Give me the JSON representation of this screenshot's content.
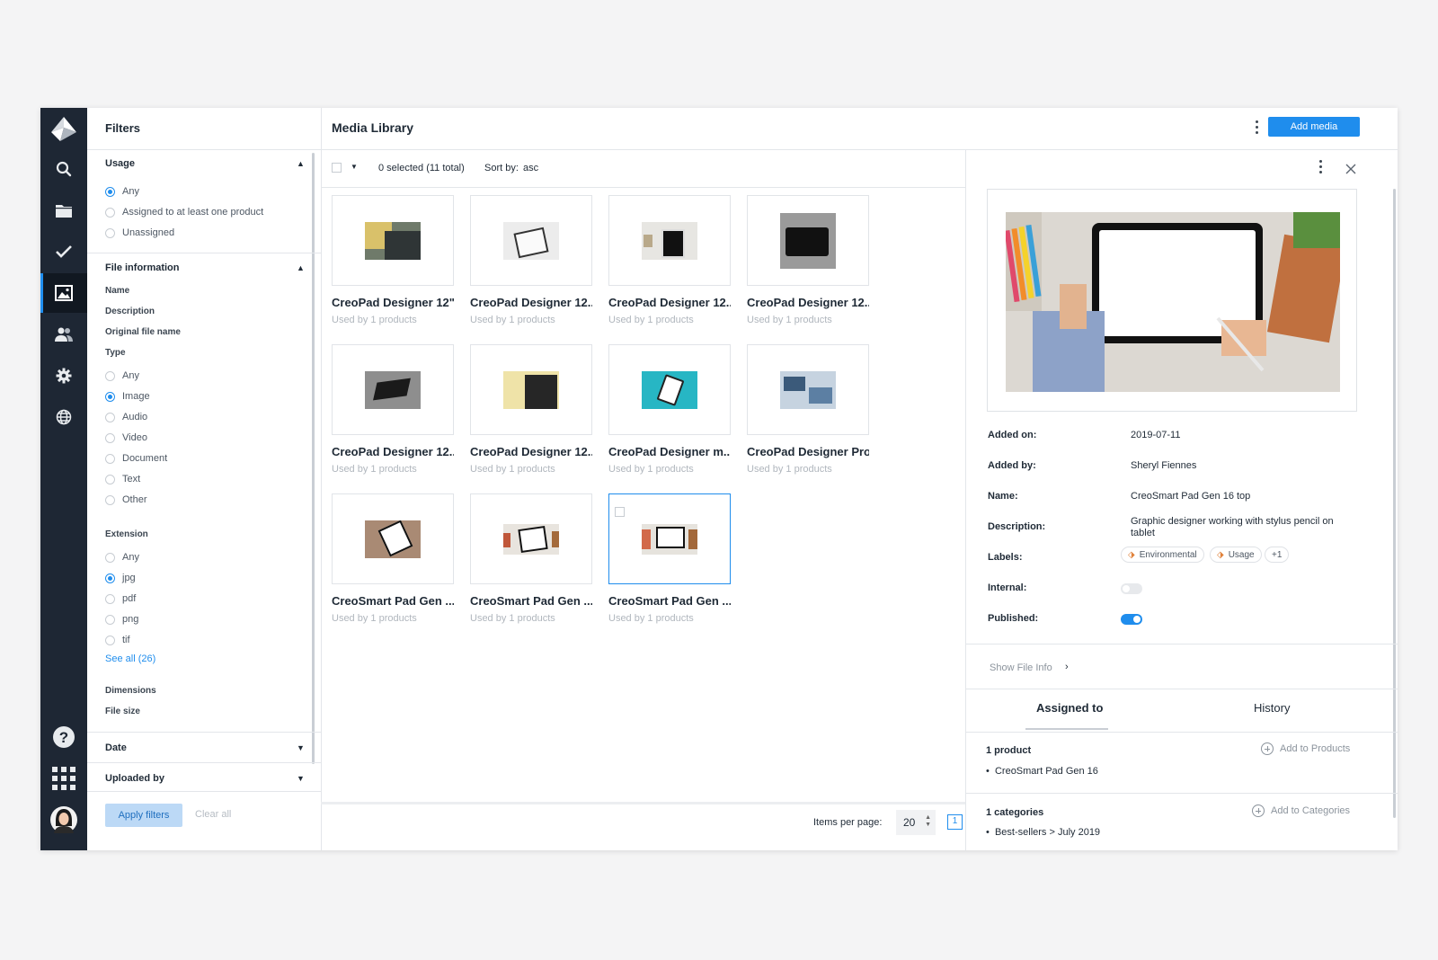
{
  "sidebar": {
    "nav": [
      "logo-icon",
      "search-icon",
      "folder-icon",
      "check-icon",
      "image-icon",
      "users-icon",
      "gear-icon",
      "globe-icon",
      "help-icon",
      "apps-grid-icon",
      "avatar"
    ]
  },
  "filters": {
    "title": "Filters",
    "usage": {
      "title": "Usage",
      "options": [
        "Any",
        "Assigned to at least one product",
        "Unassigned"
      ],
      "selected": "Any"
    },
    "file_info": {
      "title": "File information",
      "fields": [
        "Name",
        "Description",
        "Original file name"
      ],
      "type_label": "Type",
      "type_options": [
        "Any",
        "Image",
        "Audio",
        "Video",
        "Document",
        "Text",
        "Other"
      ],
      "type_selected": "Image",
      "extension_label": "Extension",
      "extension_options": [
        "Any",
        "jpg",
        "pdf",
        "png",
        "tif"
      ],
      "extension_selected": "jpg",
      "see_all": "See all (26)",
      "dimensions": "Dimensions",
      "file_size": "File size"
    },
    "date": "Date",
    "uploaded_by": "Uploaded by",
    "apply": "Apply filters",
    "clear": "Clear all"
  },
  "header": {
    "title": "Media Library",
    "add_media": "Add media"
  },
  "toolbar": {
    "selected": "0 selected (11 total)",
    "sort_label": "Sort by:",
    "sort_value": "asc"
  },
  "media": [
    {
      "name": "CreoPad Designer 12\"",
      "usage": "Used by 1 products"
    },
    {
      "name": "CreoPad Designer 12...",
      "usage": "Used by 1 products"
    },
    {
      "name": "CreoPad Designer 12...",
      "usage": "Used by 1 products"
    },
    {
      "name": "CreoPad Designer 12...",
      "usage": "Used by 1 products"
    },
    {
      "name": "CreoPad Designer 12...",
      "usage": "Used by 1 products"
    },
    {
      "name": "CreoPad Designer 12...",
      "usage": "Used by 1 products"
    },
    {
      "name": "CreoPad Designer m...",
      "usage": "Used by 1 products"
    },
    {
      "name": "CreoPad Designer Pro",
      "usage": "Used by 1 products"
    },
    {
      "name": "CreoSmart Pad Gen ...",
      "usage": "Used by 1 products"
    },
    {
      "name": "CreoSmart Pad Gen ...",
      "usage": "Used by 1 products"
    },
    {
      "name": "CreoSmart Pad Gen ...",
      "usage": "Used by 1 products"
    }
  ],
  "pagination": {
    "items_per_page_label": "Items per page:",
    "items_per_page": "20",
    "page": "1"
  },
  "details": {
    "added_on_label": "Added on:",
    "added_on": "2019-07-11",
    "added_by_label": "Added by:",
    "added_by": "Sheryl Fiennes",
    "name_label": "Name:",
    "name": "CreoSmart Pad Gen 16 top",
    "description_label": "Description:",
    "description": "Graphic designer working with stylus pencil on tablet",
    "labels_label": "Labels:",
    "labels": [
      "Environmental",
      "Usage",
      "+1"
    ],
    "internal_label": "Internal:",
    "internal": false,
    "published_label": "Published:",
    "published": true,
    "show_file_info": "Show File Info",
    "tabs": [
      "Assigned to",
      "History"
    ],
    "products_count": "1 product",
    "add_products": "Add to Products",
    "product_item": "CreoSmart Pad Gen 16",
    "categories_count": "1 categories",
    "add_categories": "Add to Categories",
    "category_item": "Best-sellers > July 2019"
  },
  "colors": {
    "accent": "#1f8ded",
    "rail": "#1e2734"
  }
}
